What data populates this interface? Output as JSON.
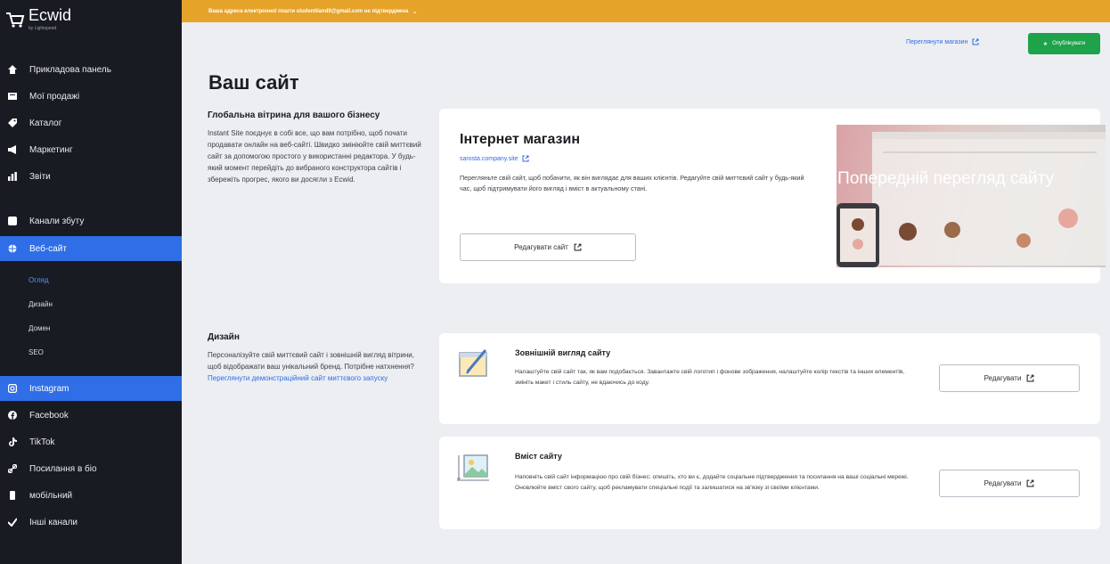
{
  "colors": {
    "sidebar_bg": "#181b22",
    "accent": "#2f6ee6",
    "banner": "#e6a32a",
    "publish": "#1ea34b"
  },
  "app": {
    "logo_name": "Ecwid",
    "logo_sub": "by Lightspeed"
  },
  "banner": {
    "text": "Ваша адреса електронної пошти studentiland9@gmail.com не підтверджена"
  },
  "sidebar": {
    "items": [
      {
        "label": "Прикладова панель",
        "icon": "home-icon"
      },
      {
        "label": "Мої продажі",
        "icon": "orders-icon"
      },
      {
        "label": "Каталог",
        "icon": "tag-icon"
      },
      {
        "label": "Маркетинг",
        "icon": "megaphone-icon"
      },
      {
        "label": "Звіти",
        "icon": "chart-icon"
      },
      {
        "label": "Канали збуту",
        "icon": "channels-icon"
      },
      {
        "label": "Веб-сайт",
        "icon": "globe-icon"
      },
      {
        "label": "Instagram",
        "icon": "instagram-icon"
      },
      {
        "label": "Facebook",
        "icon": "facebook-icon"
      },
      {
        "label": "TikTok",
        "icon": "tiktok-icon"
      },
      {
        "label": "Посилання в біо",
        "icon": "link-icon"
      },
      {
        "label": "мобільний",
        "icon": "mobile-icon"
      },
      {
        "label": "Інші канали",
        "icon": "check-icon"
      }
    ],
    "subitems": [
      {
        "label": "Огляд"
      },
      {
        "label": "Дизайн"
      },
      {
        "label": "Домен"
      },
      {
        "label": "SEO"
      }
    ]
  },
  "header": {
    "view_store_link": "Переглянути магазин",
    "publish_label": "Опублікувати"
  },
  "page": {
    "title": "Ваш сайт"
  },
  "section_global": {
    "title": "Глобальна вітрина для вашого бізнесу",
    "description": "Instant Site поєднує в собі все, що вам потрібно, щоб почати продавати онлайн на веб-сайті. Швидко змініюйте свій миттєвий сайт за допомогою простого у використанні редактора. У будь-який момент перейдіть до вибраного конструктора сайтів і збережіть прогрес, якого ви досягли з Ecwid."
  },
  "store_card": {
    "title": "Інтернет магазин",
    "url": "sarosta.company.site",
    "description": "Перегляньте свій сайт, щоб побачити, як він виглядає для ваших клієнтів. Редагуйте свій миттєвий сайт у будь-який час, щоб підтримувати його вигляд і вміст в актуальному стані.",
    "edit_button": "Редагувати сайт",
    "preview_label": "Попередній перегляд сайту"
  },
  "section_design": {
    "title": "Дизайн",
    "description": "Персоналізуйте свій миттєвий сайт і зовнішній вигляд вітрини, щоб відображати ваш унікальний бренд. Потрібне натхнення?",
    "demo_link": "Переглянути демонстраційний сайт миттєвого запуску"
  },
  "appearance_card": {
    "title": "Зовнішній вигляд сайту",
    "description": "Налаштуйте свій сайт так, як вам подобається. Завантажте свій логотип і фонове зображення, налаштуйте колір текстів та інших елементів, змініть макет і стиль сайту, не вдаючись до коду.",
    "button": "Редагувати"
  },
  "content_card": {
    "title": "Вміст сайту",
    "description": "Наповніть свій сайт інформацією про свій бізнес: опишіть, хто ви є, додайте соціальне підтвердження та посилання на ваші соціальні мережі. Оновлюйте вміст свого сайту, щоб рекламувати спеціальні події та залишатися на зв'язку зі своїми клієнтами.",
    "button": "Редагувати"
  }
}
